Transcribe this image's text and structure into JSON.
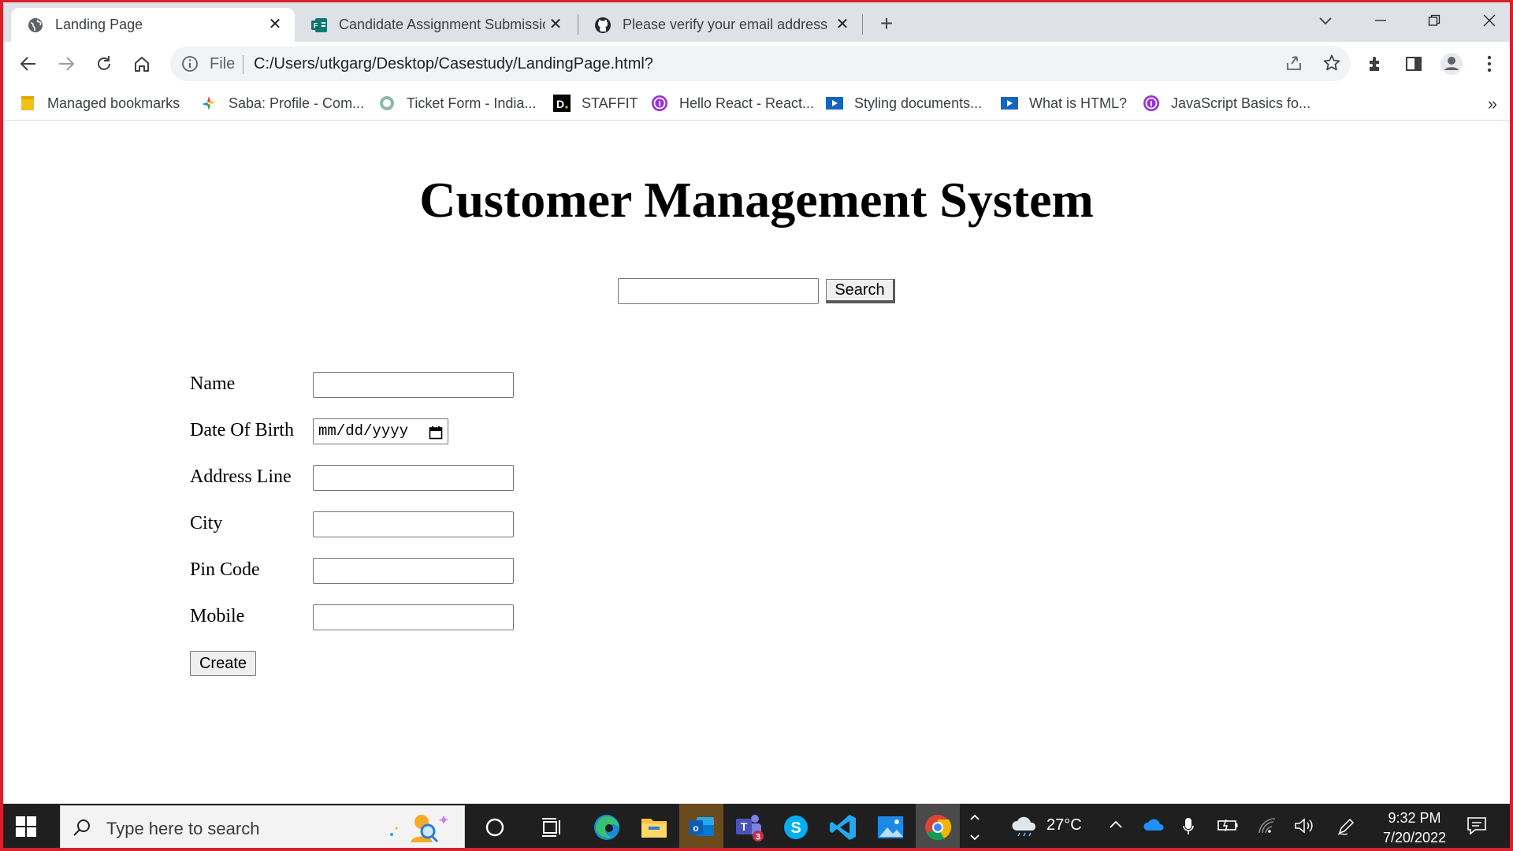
{
  "browser": {
    "tabs": [
      {
        "title": "Landing Page",
        "icon": "globe-icon",
        "active": true
      },
      {
        "title": "Candidate Assignment Submissio",
        "icon": "forms-icon",
        "active": false
      },
      {
        "title": "Please verify your email address",
        "icon": "github-icon",
        "active": false
      }
    ],
    "new_tab": "+",
    "address": {
      "scheme_label": "File",
      "url": "C:/Users/utkgarg/Desktop/Casestudy/LandingPage.html?"
    },
    "bookmarks": [
      {
        "label": "Managed bookmarks",
        "icon": "folder-icon"
      },
      {
        "label": "Saba: Profile - Com...",
        "icon": "saba-icon"
      },
      {
        "label": "Ticket Form - India...",
        "icon": "ticket-icon"
      },
      {
        "label": "STAFFIT",
        "icon": "staffit-icon"
      },
      {
        "label": "Hello React - React...",
        "icon": "react-course-icon"
      },
      {
        "label": "Styling documents...",
        "icon": "video-icon"
      },
      {
        "label": "What is HTML?",
        "icon": "video-icon"
      },
      {
        "label": "JavaScript Basics fo...",
        "icon": "course-icon"
      }
    ],
    "bookmarks_overflow": "»",
    "accent": "#d6202b"
  },
  "page": {
    "title": "Customer Management System",
    "search_button": "Search",
    "fields": [
      {
        "label": "Name",
        "type": "text",
        "value": ""
      },
      {
        "label": "Date Of Birth",
        "type": "date",
        "value": "mm/dd/yyyy"
      },
      {
        "label": "Address Line",
        "type": "text",
        "value": ""
      },
      {
        "label": "City",
        "type": "text",
        "value": ""
      },
      {
        "label": "Pin Code",
        "type": "text",
        "value": ""
      },
      {
        "label": "Mobile",
        "type": "text",
        "value": ""
      }
    ],
    "create_button": "Create"
  },
  "taskbar": {
    "search_placeholder": "Type here to search",
    "apps": [
      "cortana-icon",
      "task-view-icon",
      "edge-icon",
      "file-explorer-icon",
      "outlook-icon",
      "teams-icon",
      "skype-icon",
      "vscode-icon",
      "photos-icon",
      "chrome-icon"
    ],
    "teams_badge": "3",
    "weather": "27°C",
    "time": "9:32 PM",
    "date": "7/20/2022"
  }
}
